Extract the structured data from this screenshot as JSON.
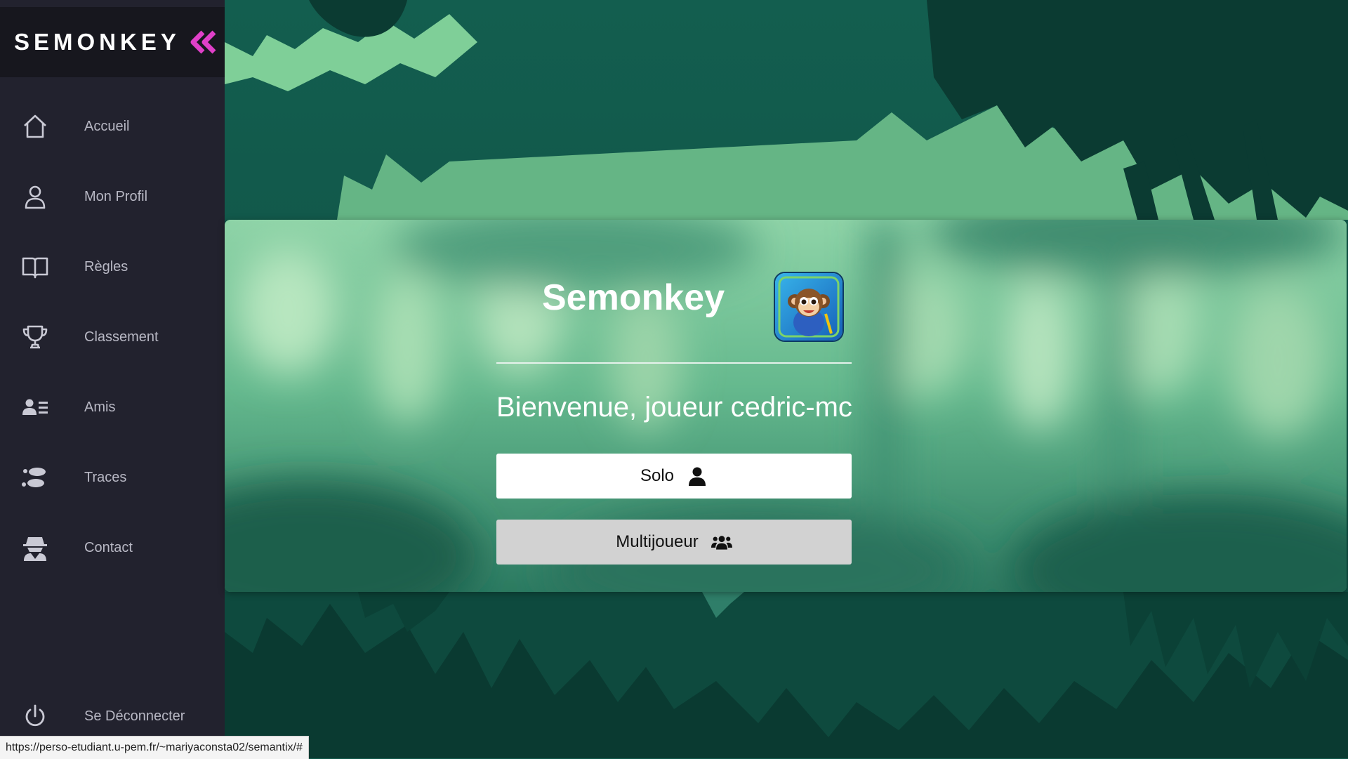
{
  "brand": {
    "name": "SEMONKEY",
    "accent": "#e040c8"
  },
  "sidebar": {
    "items": [
      {
        "label": "Accueil",
        "icon": "home-icon"
      },
      {
        "label": "Mon Profil",
        "icon": "user-icon"
      },
      {
        "label": "Règles",
        "icon": "book-icon"
      },
      {
        "label": "Classement",
        "icon": "trophy-icon"
      },
      {
        "label": "Amis",
        "icon": "contacts-list-icon"
      },
      {
        "label": "Traces",
        "icon": "footprints-icon"
      },
      {
        "label": "Contact",
        "icon": "spy-icon"
      }
    ],
    "logout": {
      "label": "Se Déconnecter",
      "icon": "power-icon"
    }
  },
  "main": {
    "title": "Semonkey",
    "app_icon": "monkey-app-icon",
    "welcome": "Bienvenue, joueur cedric-mc",
    "buttons": {
      "solo": {
        "label": "Solo",
        "icon": "single-user-icon"
      },
      "multi": {
        "label": "Multijoueur",
        "icon": "group-users-icon"
      }
    }
  },
  "status_bar": {
    "url": "https://perso-etudiant.u-pem.fr/~mariyaconsta02/semantix/#"
  },
  "colors": {
    "sidebar_bg": "#22222e",
    "brand_bg": "#17171e",
    "jungle_dark": "#0f4a3e",
    "jungle_light": "#8ccf9f",
    "panel_bg": "#4a9b7e"
  }
}
